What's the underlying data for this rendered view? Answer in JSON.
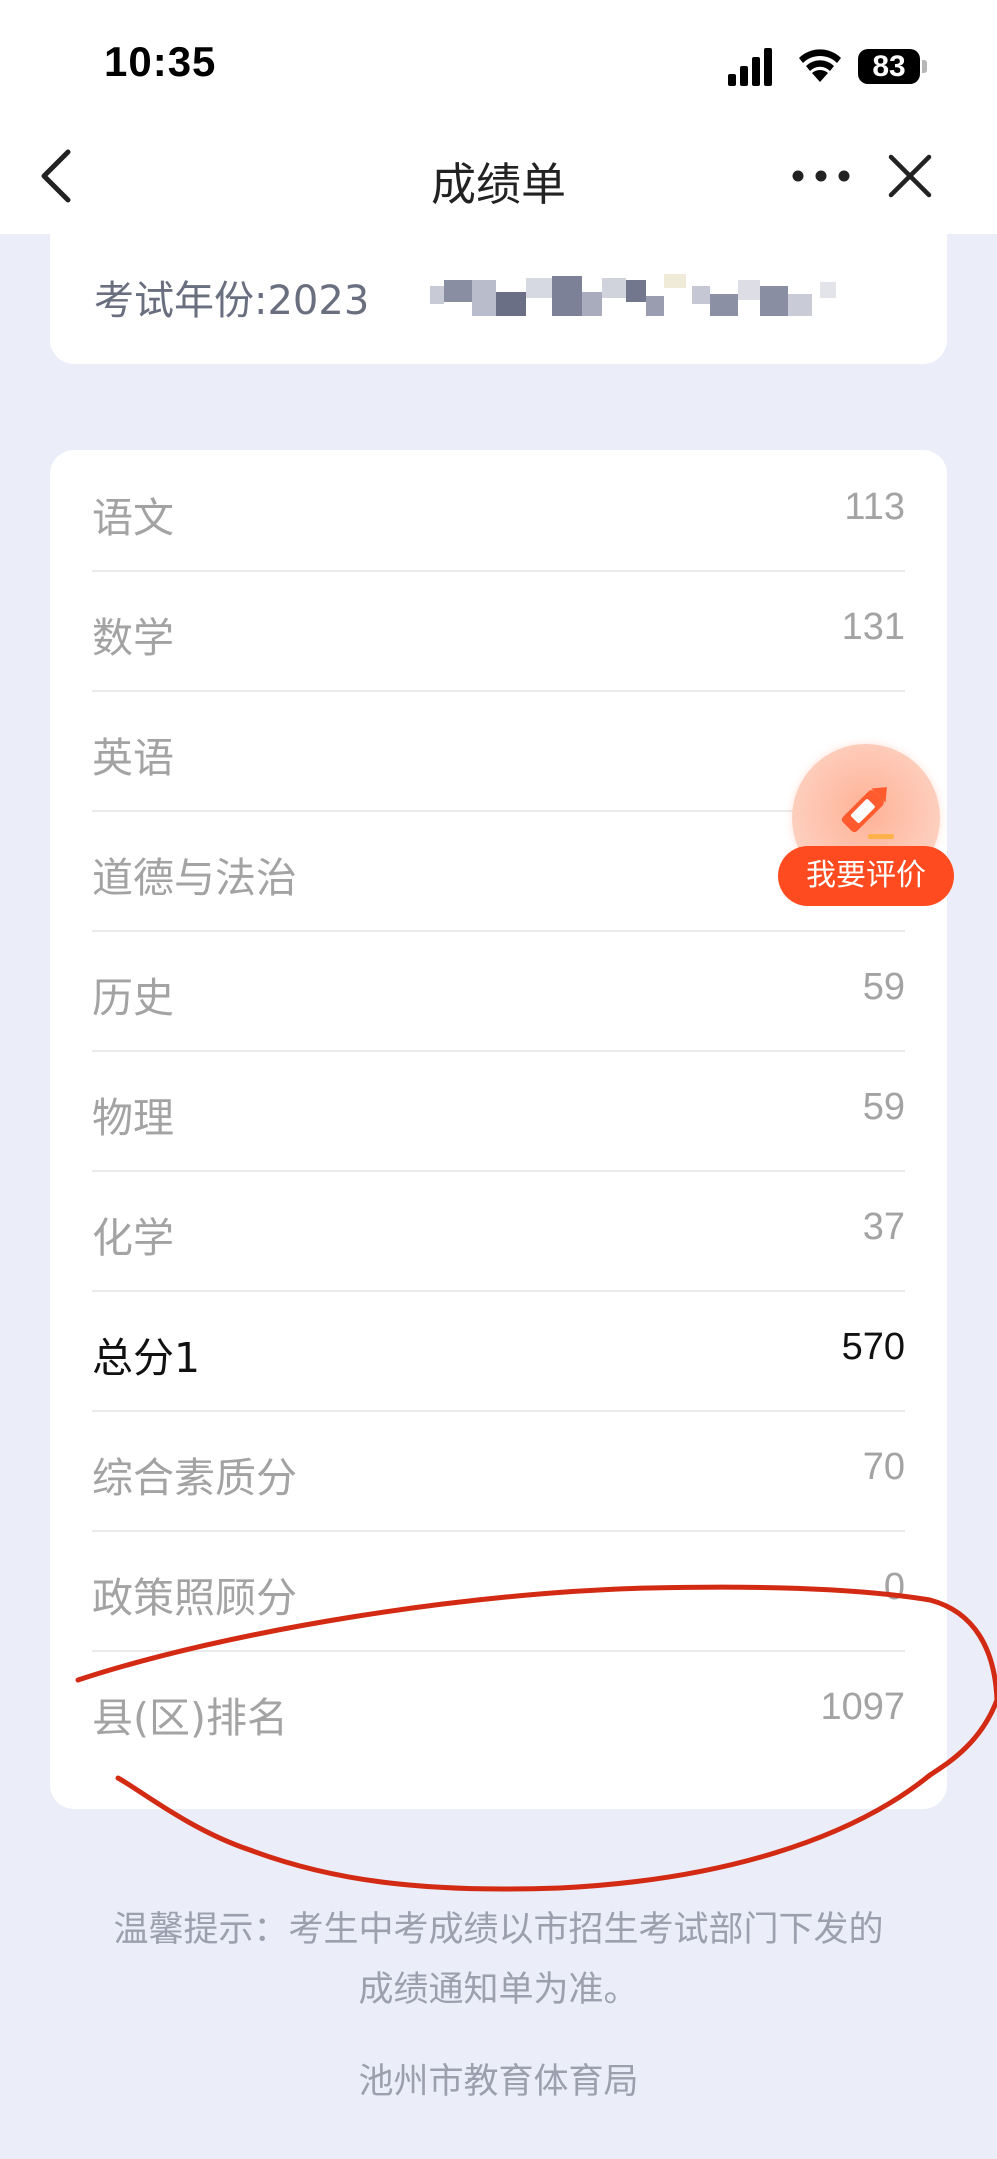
{
  "status_bar": {
    "time": "10:35",
    "battery": "83",
    "icons": [
      "signal-icon",
      "wifi-icon",
      "battery-icon"
    ]
  },
  "nav": {
    "title": "成绩单",
    "icons": [
      "back-icon",
      "more-icon",
      "close-icon"
    ]
  },
  "exam_info": {
    "year_label": "考试年份:2023"
  },
  "scores": [
    {
      "subject": "语文",
      "value": "113"
    },
    {
      "subject": "数学",
      "value": "131"
    },
    {
      "subject": "英语",
      "value": ""
    },
    {
      "subject": "道德与法治",
      "value": ""
    },
    {
      "subject": "历史",
      "value": "59"
    },
    {
      "subject": "物理",
      "value": "59"
    },
    {
      "subject": "化学",
      "value": "37"
    },
    {
      "subject": "总分1",
      "value": "570"
    },
    {
      "subject": "综合素质分",
      "value": "70"
    },
    {
      "subject": "政策照顾分",
      "value": "0"
    },
    {
      "subject": "县(区)排名",
      "value": "1097"
    }
  ],
  "review_button": {
    "label": "我要评价",
    "icon": "pencil-icon"
  },
  "footer": {
    "tip_line1": "温馨提示：考生中考成绩以市招生考试部门下发的",
    "tip_line2": "成绩通知单为准。",
    "org": "池州市教育体育局"
  },
  "colors": {
    "page_bg": "#ebeef8",
    "accent": "#ff4b1f",
    "annotation": "#d32a14"
  }
}
